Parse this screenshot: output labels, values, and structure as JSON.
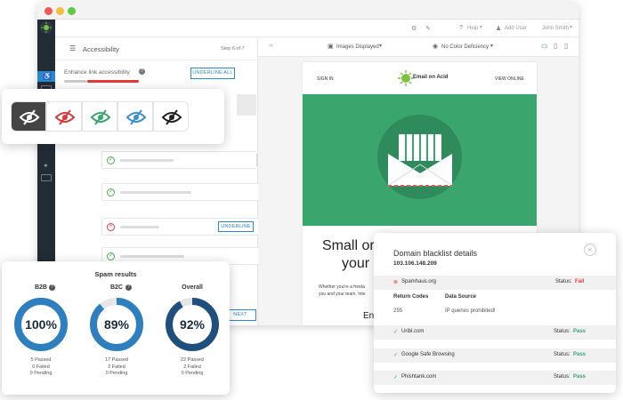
{
  "app": {
    "help_label": "Help",
    "add_user_label": "Add User",
    "user_name": "John Smith"
  },
  "panel": {
    "menu_title": "Accessibility",
    "step_label": "Step 6 of 7",
    "section_title": "Enhance link accessibility",
    "underline_all_label": "UNDERLINE ALL",
    "underline_label": "UNDERLINE",
    "next_label": "NEXT"
  },
  "preview": {
    "images_label": "Images Displayed",
    "color_label": "No Color Deficiency"
  },
  "email": {
    "sign_in": "SIGN IN",
    "brand": "Email on Acid",
    "view_online": "VIEW ONLINE",
    "headline_1": "Small or",
    "headline_2": "your",
    "body_1": "Whether you're a freela",
    "body_2": "you and your team. Inte",
    "footer_text": "En"
  },
  "spam": {
    "title": "Spam results",
    "groups": [
      {
        "label": "B2B",
        "percent": 100,
        "value_text": "100%",
        "passed": "5 Passed",
        "failed": "0 Failed",
        "pending": "0 Pending"
      },
      {
        "label": "B2C",
        "percent": 89,
        "value_text": "89%",
        "passed": "17 Passed",
        "failed": "2 Failed",
        "pending": "0 Pending"
      },
      {
        "label": "Overall",
        "percent": 92,
        "value_text": "92%",
        "passed": "22 Passed",
        "failed": "2 Failed",
        "pending": "0 Pending"
      }
    ],
    "colors": {
      "ring": "#2e7fc0",
      "ring_dark": "#1e4f7d",
      "track": "#e6e6e6"
    }
  },
  "blacklist": {
    "title": "Domain blacklist details",
    "ip": "103.106.148.209",
    "status_label": "Status:",
    "rows": [
      {
        "name": "Spamhaus.org",
        "status": "Fail"
      },
      {
        "name": "Uribl.com",
        "status": "Pass"
      },
      {
        "name": "Google Safe Browsing",
        "status": "Pass"
      },
      {
        "name": "Phishtank.com",
        "status": "Pass"
      }
    ],
    "return_codes_header": "Return Codes",
    "data_source_header": "Data Source",
    "return_code": "255",
    "data_source": "IP queries prohibited!"
  },
  "colors": {
    "accent": "#2e88c7",
    "green": "#3aa66e",
    "red": "#e53935",
    "sidebar": "#232b35"
  }
}
